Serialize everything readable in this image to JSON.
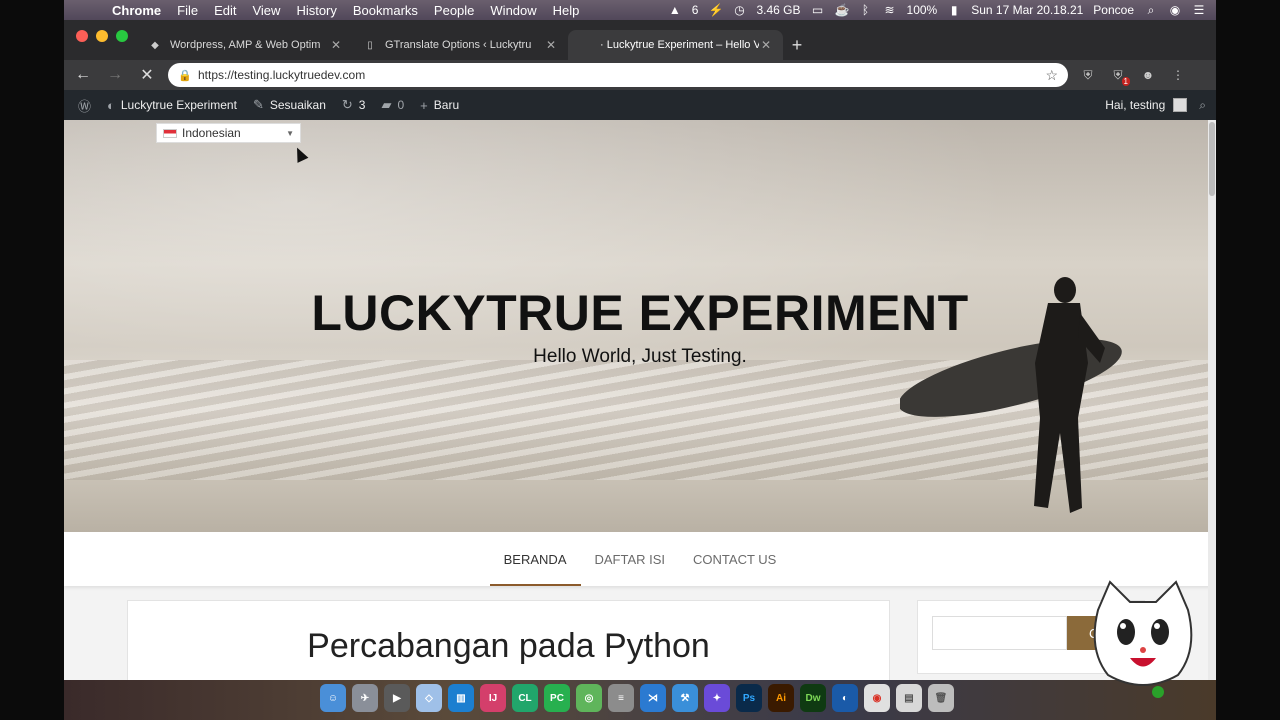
{
  "menubar": {
    "app_name": "Chrome",
    "menus": [
      "File",
      "Edit",
      "View",
      "History",
      "Bookmarks",
      "People",
      "Window",
      "Help"
    ],
    "status": {
      "count": "6",
      "memory": "3.46 GB",
      "battery": "100%",
      "datetime": "Sun 17 Mar  20.18.21",
      "user": "Poncoe"
    }
  },
  "tabs": [
    {
      "title": "Wordpress, AMP & Web Optim",
      "active": false
    },
    {
      "title": "GTranslate Options ‹ Luckytru",
      "active": false
    },
    {
      "title": "Luckytrue Experiment – Hello V",
      "active": true
    }
  ],
  "toolbar": {
    "url": "https://testing.luckytruedev.com",
    "extension_badge": "1"
  },
  "adminbar": {
    "site_name": "Luckytrue Experiment",
    "customize": "Sesuaikan",
    "updates_count": "3",
    "comments_count": "0",
    "new_label": "Baru",
    "greeting": "Hai, testing"
  },
  "language_selector": {
    "selected": "Indonesian"
  },
  "hero": {
    "title": "LUCKYTRUE EXPERIMENT",
    "subtitle": "Hello World, Just Testing."
  },
  "nav": {
    "items": [
      "BERANDA",
      "DAFTAR ISI",
      "CONTACT US"
    ],
    "active_index": 0
  },
  "post": {
    "title": "Percabangan pada Python"
  },
  "sidebar": {
    "search_button_fragment": "C"
  },
  "colors": {
    "accent": "#8b5a2b",
    "adminbar": "#23282d",
    "button": "#8b6a3a"
  },
  "dock": {
    "apps": [
      "Finder",
      "Launchpad",
      "Final Cut",
      "Cube",
      "Trello",
      "IntelliJ",
      "CLion",
      "PyCharm",
      "Android Studio",
      "Sequel",
      "VS Code",
      "Xcode",
      "Figma",
      "Ps",
      "Ai",
      "Dw",
      "Safari",
      "Chrome",
      "Files",
      "Trash"
    ]
  }
}
